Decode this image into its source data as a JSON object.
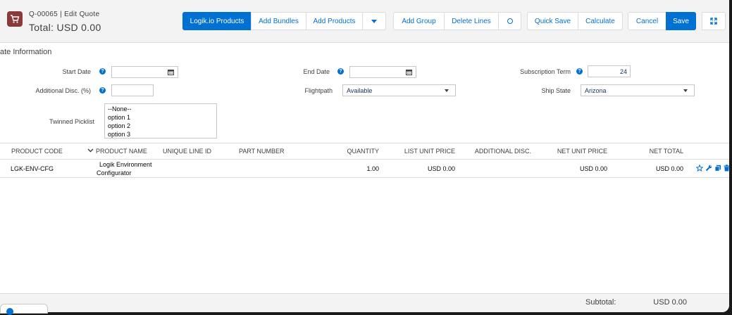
{
  "header": {
    "quote_number": "Q-00065 | Edit Quote",
    "total": "Total: USD 0.00",
    "icon": "cart-icon"
  },
  "toolbar": {
    "logik_products": "Logik.io Products",
    "add_bundles": "Add Bundles",
    "add_products": "Add Products",
    "more_menu_icon": "chevron-down-icon",
    "add_group": "Add Group",
    "delete_lines": "Delete Lines",
    "toggle_icon": "circle-icon",
    "quick_save": "Quick Save",
    "calculate": "Calculate",
    "cancel": "Cancel",
    "save": "Save",
    "expand_icon": "expand-icon"
  },
  "section": {
    "title": "ate Information"
  },
  "fields": {
    "start_date": {
      "label": "Start Date",
      "value": ""
    },
    "end_date": {
      "label": "End Date",
      "value": ""
    },
    "subscription_term": {
      "label": "Subscription Term",
      "value": "24"
    },
    "additional_disc": {
      "label": "Additional Disc. (%)",
      "value": ""
    },
    "flightpath": {
      "label": "Flightpath",
      "value": "Available"
    },
    "ship_state": {
      "label": "Ship State",
      "value": "Arizona"
    },
    "twinned_picklist": {
      "label": "Twinned Picklist",
      "options": [
        "--None--",
        "option 1",
        "option 2",
        "option 3"
      ]
    }
  },
  "table": {
    "columns": [
      "PRODUCT CODE",
      "PRODUCT NAME",
      "UNIQUE LINE ID",
      "PART NUMBER",
      "QUANTITY",
      "LIST UNIT PRICE",
      "ADDITIONAL DISC.",
      "NET UNIT PRICE",
      "NET TOTAL"
    ],
    "rows": [
      {
        "product_code": "LGK-ENV-CFG",
        "product_name_line1": "Logik Environment",
        "product_name_line2": "Configurator",
        "unique_line_id": "",
        "part_number": "",
        "quantity": "1.00",
        "list_unit_price": "USD 0.00",
        "additional_disc": "",
        "net_unit_price": "USD 0.00",
        "net_total": "USD 0.00",
        "action_icons": [
          "star-icon",
          "wrench-icon",
          "copy-icon",
          "trash-icon"
        ]
      }
    ]
  },
  "footer": {
    "subtotal_label": "Subtotal:",
    "subtotal_value": "USD 0.00"
  },
  "colors": {
    "brand": "#0070d2",
    "header_bg": "#f3f3f3",
    "app_icon_bg": "#8a3a3a",
    "text": "#3e3e3c"
  }
}
